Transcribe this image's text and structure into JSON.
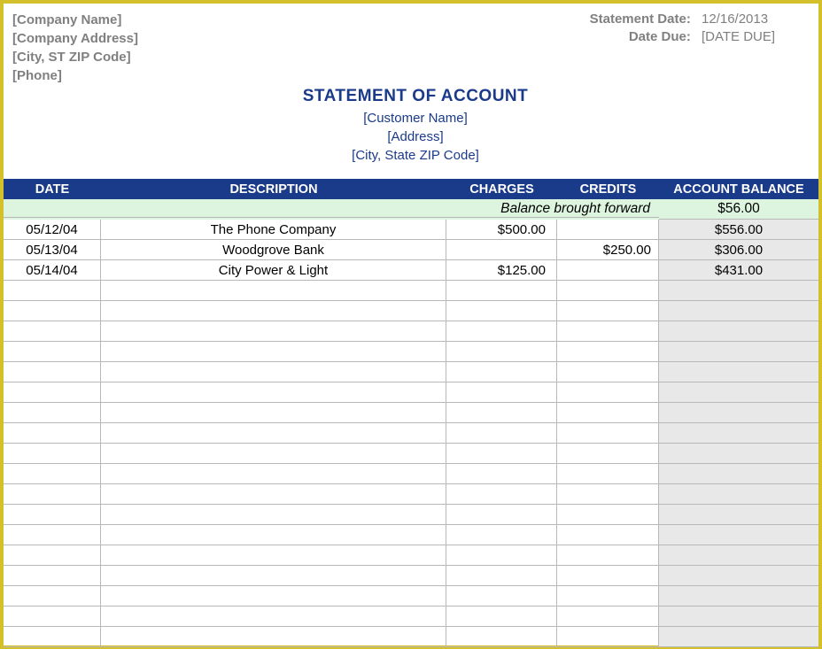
{
  "company": {
    "name": "[Company Name]",
    "address": "[Company Address]",
    "city": "[City, ST  ZIP Code]",
    "phone": "[Phone]"
  },
  "statement": {
    "dateLabel": "Statement Date:",
    "dateValue": "12/16/2013",
    "dueLabel": "Date Due:",
    "dueValue": "[DATE DUE]"
  },
  "title": "STATEMENT OF ACCOUNT",
  "customer": {
    "name": "[Customer Name]",
    "address": "[Address]",
    "city": "[City, State  ZIP Code]"
  },
  "columns": {
    "date": "DATE",
    "desc": "DESCRIPTION",
    "charges": "CHARGES",
    "credits": "CREDITS",
    "balance": "ACCOUNT BALANCE"
  },
  "balanceForward": {
    "label": "Balance brought forward",
    "value": "$56.00"
  },
  "rows": [
    {
      "date": "05/12/04",
      "desc": "The Phone Company",
      "charges": "$500.00",
      "credits": "",
      "balance": "$556.00"
    },
    {
      "date": "05/13/04",
      "desc": "Woodgrove Bank",
      "charges": "",
      "credits": "$250.00",
      "balance": "$306.00"
    },
    {
      "date": "05/14/04",
      "desc": "City Power & Light",
      "charges": "$125.00",
      "credits": "",
      "balance": "$431.00"
    },
    {
      "date": "",
      "desc": "",
      "charges": "",
      "credits": "",
      "balance": ""
    },
    {
      "date": "",
      "desc": "",
      "charges": "",
      "credits": "",
      "balance": ""
    },
    {
      "date": "",
      "desc": "",
      "charges": "",
      "credits": "",
      "balance": ""
    },
    {
      "date": "",
      "desc": "",
      "charges": "",
      "credits": "",
      "balance": ""
    },
    {
      "date": "",
      "desc": "",
      "charges": "",
      "credits": "",
      "balance": ""
    },
    {
      "date": "",
      "desc": "",
      "charges": "",
      "credits": "",
      "balance": ""
    },
    {
      "date": "",
      "desc": "",
      "charges": "",
      "credits": "",
      "balance": ""
    },
    {
      "date": "",
      "desc": "",
      "charges": "",
      "credits": "",
      "balance": ""
    },
    {
      "date": "",
      "desc": "",
      "charges": "",
      "credits": "",
      "balance": ""
    },
    {
      "date": "",
      "desc": "",
      "charges": "",
      "credits": "",
      "balance": ""
    },
    {
      "date": "",
      "desc": "",
      "charges": "",
      "credits": "",
      "balance": ""
    },
    {
      "date": "",
      "desc": "",
      "charges": "",
      "credits": "",
      "balance": ""
    },
    {
      "date": "",
      "desc": "",
      "charges": "",
      "credits": "",
      "balance": ""
    },
    {
      "date": "",
      "desc": "",
      "charges": "",
      "credits": "",
      "balance": ""
    },
    {
      "date": "",
      "desc": "",
      "charges": "",
      "credits": "",
      "balance": ""
    },
    {
      "date": "",
      "desc": "",
      "charges": "",
      "credits": "",
      "balance": ""
    },
    {
      "date": "",
      "desc": "",
      "charges": "",
      "credits": "",
      "balance": ""
    },
    {
      "date": "",
      "desc": "",
      "charges": "",
      "credits": "",
      "balance": ""
    }
  ]
}
